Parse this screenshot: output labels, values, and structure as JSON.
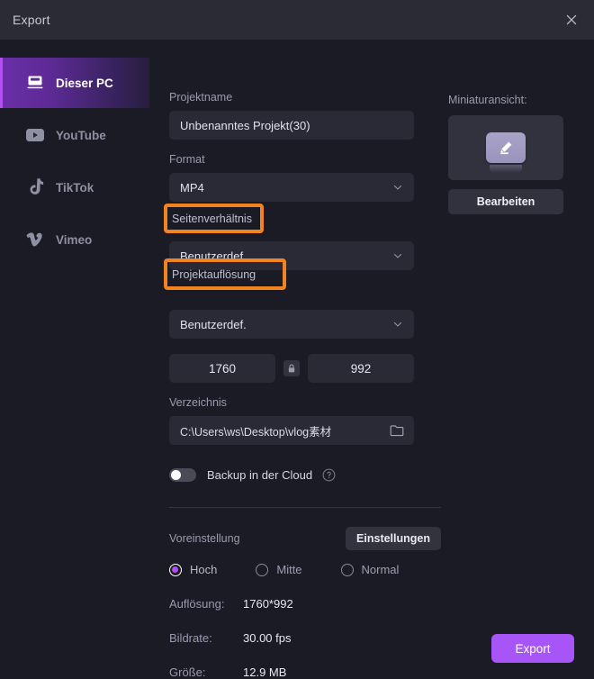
{
  "window": {
    "title": "Export",
    "close_icon": "close-icon"
  },
  "sidebar": {
    "items": [
      {
        "label": "Dieser PC",
        "icon": "monitor-icon",
        "active": true
      },
      {
        "label": "YouTube",
        "icon": "youtube-icon",
        "active": false
      },
      {
        "label": "TikTok",
        "icon": "tiktok-icon",
        "active": false
      },
      {
        "label": "Vimeo",
        "icon": "vimeo-icon",
        "active": false
      }
    ]
  },
  "form": {
    "project_name_label": "Projektname",
    "project_name_value": "Unbenanntes Projekt(30)",
    "format_label": "Format",
    "format_value": "MP4",
    "aspect_label": "Seitenverhältnis",
    "aspect_value": "Benutzerdef.",
    "resolution_label": "Projektauflösung",
    "resolution_value": "Benutzerdef.",
    "width_value": "1760",
    "height_value": "992",
    "lock_icon": "lock-icon",
    "directory_label": "Verzeichnis",
    "directory_value": "C:\\Users\\ws\\Desktop\\vlog素材",
    "folder_icon": "folder-icon",
    "backup_label": "Backup in der Cloud",
    "backup_enabled": false,
    "help_icon": "question-mark-icon"
  },
  "preset": {
    "label": "Voreinstellung",
    "settings_button": "Einstellungen",
    "options": [
      {
        "label": "Hoch",
        "checked": true
      },
      {
        "label": "Mitte",
        "checked": false
      },
      {
        "label": "Normal",
        "checked": false
      }
    ]
  },
  "info": {
    "rows": [
      {
        "key": "Auflösung:",
        "value": "1760*992"
      },
      {
        "key": "Bildrate:",
        "value": "30.00 fps"
      },
      {
        "key": "Größe:",
        "value": "12.9 MB"
      }
    ]
  },
  "thumbnail": {
    "label": "Miniaturansicht:",
    "edit_button": "Bearbeiten",
    "preview_icon": "pencil-edit-icon"
  },
  "actions": {
    "export_label": "Export"
  },
  "highlights": {
    "aspect_label": "Seitenverhältnis",
    "resolution_label": "Projektauflösung",
    "color": "#f2831e"
  },
  "colors": {
    "accent_purple": "#a855f7",
    "panel_bg": "#1b1b25",
    "titlebar_bg": "#2b2b36",
    "field_bg": "#2a2a36",
    "highlight_orange": "#f2831e"
  }
}
